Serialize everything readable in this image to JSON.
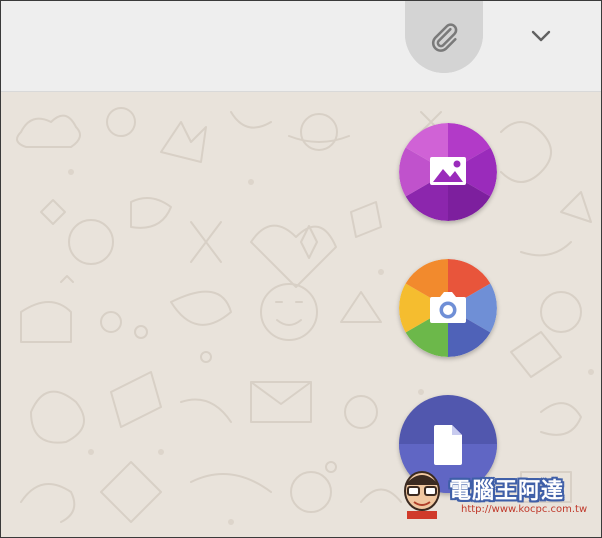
{
  "header": {
    "attach_icon": "paperclip-icon",
    "menu_icon": "chevron-down-icon"
  },
  "attachment_menu": {
    "items": [
      {
        "name": "gallery",
        "icon": "image-icon",
        "colors": [
          "#c850c0",
          "#a233c7",
          "#8a24a8",
          "#6f1a8e",
          "#b043c9",
          "#d35fd6"
        ]
      },
      {
        "name": "camera",
        "icon": "camera-icon",
        "colors": [
          "#e85a3c",
          "#f08a30",
          "#f7c23a",
          "#7cbd4f",
          "#3f8fd4",
          "#5a4fb3"
        ]
      },
      {
        "name": "document",
        "icon": "document-icon",
        "colors": [
          "#5157ae",
          "#6066c4"
        ]
      }
    ]
  },
  "watermark": {
    "title": "電腦王阿達",
    "url": "http://www.kocpc.com.tw"
  }
}
